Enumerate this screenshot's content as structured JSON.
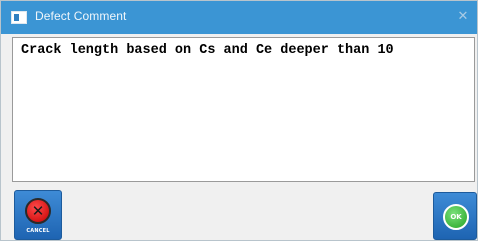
{
  "window": {
    "title": "Defect Comment",
    "close_glyph": "✕",
    "icon": "app-window-icon"
  },
  "comment": {
    "value": "Crack length based on Cs and Ce deeper than 10"
  },
  "buttons": {
    "cancel": {
      "label": "CANCEL",
      "glyph": "✕",
      "icon": "cancel-circle-icon",
      "color": "#e01515"
    },
    "ok": {
      "label": "OK",
      "icon": "ok-circle-icon",
      "color": "#3cc23c"
    }
  },
  "colors": {
    "titlebar": "#3b95d4",
    "button": "#2a74c4"
  }
}
